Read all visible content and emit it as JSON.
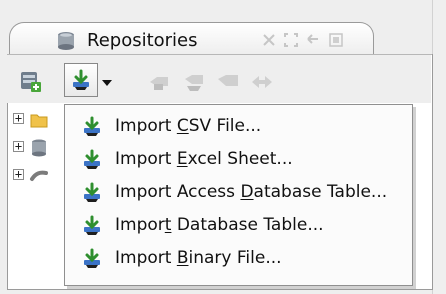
{
  "tab": {
    "title": "Repositories",
    "icons": [
      "database-icon",
      "close-icon",
      "maximize-icon",
      "restore-icon",
      "minimize-icon"
    ]
  },
  "toolbar": {
    "buttons": [
      "add-repository-icon",
      "import-icon",
      "dropdown-arrow-icon",
      "repository-action-1-icon",
      "repository-action-2-icon",
      "repository-action-3-icon",
      "transfer-icon"
    ]
  },
  "tree": {
    "nodes": [
      {
        "toggle": "+",
        "icon": "folder-icon"
      },
      {
        "toggle": "+",
        "icon": "database-icon"
      },
      {
        "toggle": "+",
        "icon": "link-icon"
      }
    ]
  },
  "menu": {
    "items": [
      {
        "label_prefix": "Import ",
        "mnemonic": "C",
        "label_suffix": "SV File...",
        "icon": "import-icon"
      },
      {
        "label_prefix": "Import ",
        "mnemonic": "E",
        "label_suffix": "xcel Sheet...",
        "icon": "import-icon"
      },
      {
        "label_prefix": "Import Access ",
        "mnemonic": "D",
        "label_suffix": "atabase Table...",
        "icon": "import-icon"
      },
      {
        "label_prefix": "Impor",
        "mnemonic": "t",
        "label_suffix": " Database Table...",
        "icon": "import-icon"
      },
      {
        "label_prefix": "Import ",
        "mnemonic": "B",
        "label_suffix": "inary File...",
        "icon": "import-icon"
      }
    ]
  },
  "colors": {
    "accent_green": "#2f8f2f",
    "accent_blue": "#3b73c6",
    "disabled": "#b9b9b9"
  }
}
